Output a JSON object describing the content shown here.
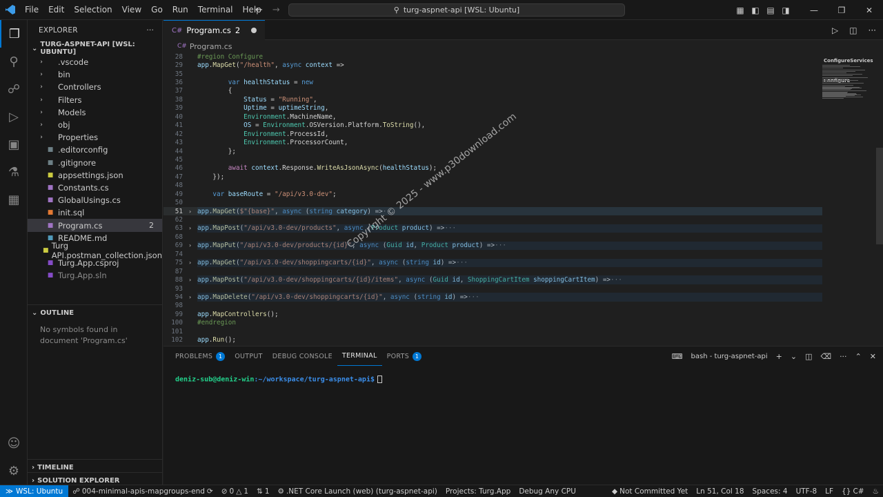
{
  "titlebar": {
    "menu": [
      "File",
      "Edit",
      "Selection",
      "View",
      "Go",
      "Run",
      "Terminal",
      "Help"
    ],
    "command_center": "turg-aspnet-api [WSL: Ubuntu]"
  },
  "explorer": {
    "title": "EXPLORER",
    "root": "TURG-ASPNET-API [WSL: UBUNTU]",
    "items": [
      {
        "label": ".vscode",
        "type": "folder"
      },
      {
        "label": "bin",
        "type": "folder"
      },
      {
        "label": "Controllers",
        "type": "folder"
      },
      {
        "label": "Filters",
        "type": "folder"
      },
      {
        "label": "Models",
        "type": "folder"
      },
      {
        "label": "obj",
        "type": "folder"
      },
      {
        "label": "Properties",
        "type": "folder"
      },
      {
        "label": ".editorconfig",
        "type": "file"
      },
      {
        "label": ".gitignore",
        "type": "file"
      },
      {
        "label": "appsettings.json",
        "type": "file"
      },
      {
        "label": "Constants.cs",
        "type": "file"
      },
      {
        "label": "GlobalUsings.cs",
        "type": "file"
      },
      {
        "label": "init.sql",
        "type": "file"
      },
      {
        "label": "Program.cs",
        "type": "file",
        "count": "2"
      },
      {
        "label": "README.md",
        "type": "file"
      },
      {
        "label": "Turg API.postman_collection.json",
        "type": "file"
      },
      {
        "label": "Turg.App.csproj",
        "type": "file"
      },
      {
        "label": "Turg.App.sln",
        "type": "file"
      }
    ]
  },
  "outline": {
    "title": "OUTLINE",
    "empty": "No symbols found in document 'Program.cs'"
  },
  "timeline": {
    "title": "TIMELINE"
  },
  "solution_explorer": {
    "title": "SOLUTION EXPLORER"
  },
  "editor": {
    "tab_label": "Program.cs",
    "tab_count": "2",
    "breadcrumb": "Program.cs",
    "lines": [
      {
        "n": "28",
        "t": "#region Configure"
      },
      {
        "n": "29",
        "t": "app.MapGet(\"/health\", async context =>"
      },
      {
        "n": "35",
        "t": ""
      },
      {
        "n": "36",
        "t": "        var healthStatus = new"
      },
      {
        "n": "37",
        "t": "        {"
      },
      {
        "n": "38",
        "t": "            Status = \"Running\","
      },
      {
        "n": "39",
        "t": "            Uptime = uptimeString,"
      },
      {
        "n": "40",
        "t": "            Environment.MachineName,"
      },
      {
        "n": "41",
        "t": "            OS = Environment.OSVersion.Platform.ToString(),"
      },
      {
        "n": "42",
        "t": "            Environment.ProcessId,"
      },
      {
        "n": "43",
        "t": "            Environment.ProcessorCount,"
      },
      {
        "n": "44",
        "t": "        };"
      },
      {
        "n": "45",
        "t": ""
      },
      {
        "n": "46",
        "t": "        await context.Response.WriteAsJsonAsync(healthStatus);"
      },
      {
        "n": "47",
        "t": "    });"
      },
      {
        "n": "48",
        "t": ""
      },
      {
        "n": "49",
        "t": "    var baseRoute = \"/api/v3.0-dev\";"
      },
      {
        "n": "50",
        "t": ""
      },
      {
        "n": "51",
        "t": "app.MapGet($\"{base}\", async (string category) =>···"
      },
      {
        "n": "62",
        "t": ""
      },
      {
        "n": "63",
        "t": "app.MapPost(\"/api/v3.0-dev/products\", async (Product product) =>···"
      },
      {
        "n": "68",
        "t": ""
      },
      {
        "n": "69",
        "t": "app.MapPut(\"/api/v3.0-dev/products/{id}\", async (Guid id, Product product) =>···"
      },
      {
        "n": "74",
        "t": ""
      },
      {
        "n": "75",
        "t": "app.MapGet(\"/api/v3.0-dev/shoppingcarts/{id}\", async (string id) =>···"
      },
      {
        "n": "87",
        "t": ""
      },
      {
        "n": "88",
        "t": "app.MapPost(\"/api/v3.0-dev/shoppingcarts/{id}/items\", async (Guid id, ShoppingCartItem shoppingCartItem) =>···"
      },
      {
        "n": "93",
        "t": ""
      },
      {
        "n": "94",
        "t": "app.MapDelete(\"/api/v3.0-dev/shoppingcarts/{id}\", async (string id) =>···"
      },
      {
        "n": "98",
        "t": ""
      },
      {
        "n": "99",
        "t": "app.MapControllers();"
      },
      {
        "n": "100",
        "t": "#endregion"
      },
      {
        "n": "101",
        "t": ""
      },
      {
        "n": "102",
        "t": "app.Run();"
      }
    ],
    "minimap_labels": [
      "ConfigureServices",
      "Configure"
    ]
  },
  "watermark": "Copyright © 2025 - www.p30download.com",
  "panel": {
    "tabs": [
      {
        "label": "PROBLEMS",
        "badge": "1"
      },
      {
        "label": "OUTPUT"
      },
      {
        "label": "DEBUG CONSOLE"
      },
      {
        "label": "TERMINAL",
        "active": true
      },
      {
        "label": "PORTS",
        "badge": "1"
      }
    ],
    "terminal_name": "bash - turg-aspnet-api",
    "prompt_user": "deniz-sub@deniz-win",
    "prompt_path": ":~/workspace/turg-aspnet-api$"
  },
  "statusbar": {
    "remote": "WSL: Ubuntu",
    "branch": "004-minimal-apis-mapgroups-end",
    "errors": "0",
    "warnings": "1",
    "ports": "1",
    "launch": ".NET Core Launch (web) (turg-aspnet-api)",
    "projects": "Projects: Turg.App",
    "debug": "Debug Any CPU",
    "commit": "Not Committed Yet",
    "position": "Ln 51, Col 18",
    "spaces": "Spaces: 4",
    "encoding": "UTF-8",
    "eol": "LF",
    "lang": "C#"
  },
  "colors": {
    "accent": "#0078d4",
    "background": "#1e1e1e",
    "prompt": "#23d18b",
    "path": "#3b8eea"
  }
}
